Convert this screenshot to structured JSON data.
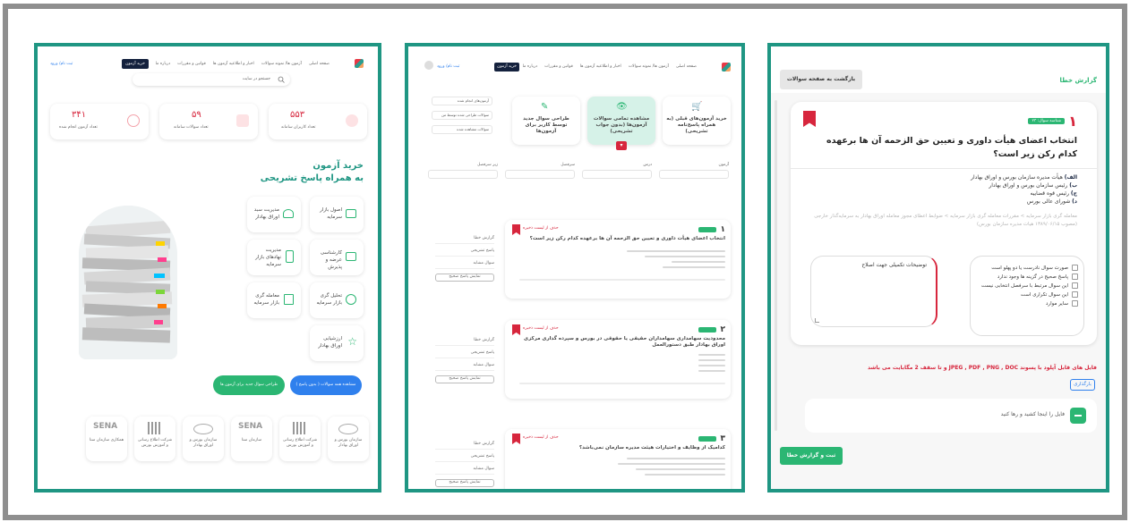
{
  "panel1": {
    "nav": [
      "صفحه اصلی",
      "آزمون ها/ نمونه سوالات",
      "اخبار و اطلاعیه آزمون ها",
      "قوانین و مقررات",
      "درباره ما"
    ],
    "buy_button": "خرید آزمون",
    "user_label": "ثبت نام/ ورود",
    "search_placeholder": "جستجو در سایت",
    "stats": [
      {
        "value": "۵۵۳",
        "label": "تعداد کاربران سامانه"
      },
      {
        "value": "۵۹",
        "label": "تعداد سوالات سامانه"
      },
      {
        "value": "۳۴۱",
        "label": "تعداد آزمون انجام شده"
      }
    ],
    "hero_title": "خرید آزمون",
    "hero_subtitle": "به همراه پاسخ تشریحی",
    "features": [
      {
        "label": "اصول بازار سرمایه"
      },
      {
        "label": "مدیریت سبد اوراق بهادار"
      },
      {
        "label": "کارشناسی عرضه و پذیرش"
      },
      {
        "label": "مدیریت نهادهای بازار سرمایه"
      },
      {
        "label": "تحلیل گری بازار سرمایه"
      },
      {
        "label": "معامله گری بازار سرمایه"
      },
      {
        "label": "ارزشیابی اوراق بهادار"
      }
    ],
    "cta_blue": "مشاهده همه سوالات ( بدون پاسخ )",
    "cta_green": "طراحی سوال جدید برای آزمون ها",
    "partners": [
      {
        "logo": "",
        "name": "سازمان بورس و اوراق بهادار"
      },
      {
        "logo": "",
        "name": "شرکت اطلاع رسانی و آموزش بورس"
      },
      {
        "logo": "SENA",
        "name": "سازمان سنا"
      },
      {
        "logo": "",
        "name": "سازمان بورس و اوراق بهادار"
      },
      {
        "logo": "",
        "name": "شرکت اطلاع رسانی و آموزش بورس"
      },
      {
        "logo": "SENA",
        "name": "همکاری سازمان سنا"
      }
    ]
  },
  "panel2": {
    "nav": [
      "صفحه اصلی",
      "آزمون ها/ نمونه سوالات",
      "اخبار و اطلاعیه آزمون ها",
      "قوانین و مقررات",
      "درباره ما"
    ],
    "buy_button": "خرید آزمون",
    "user_label": "ثبت نام/ ورود",
    "options": [
      {
        "label": "خرید آزمون‌های قبلی (به همراه پاسخ‌نامه تشریحی)"
      },
      {
        "label": "مشاهده تمامی سوالات آزمون‌ها (بدون جواب تشریحی)"
      },
      {
        "label": "طراحی سوال جدید توسط کاربر برای آزمون‌ها"
      }
    ],
    "side_links": [
      "آزمون‌های انجام شده",
      "سوالات طراحی شده توسط من",
      "سوالات مشاهده شده"
    ],
    "filters": [
      "آزمون",
      "درس",
      "سرفصل",
      "زیر سرفصل"
    ],
    "questions": [
      {
        "num": "۱",
        "text": "انتخاب اعضای هیأت داوری و تعیین حق الزحمه آن ها برعهده کدام رکن زیر است؟",
        "save": "حذف از لیست ذخیره"
      },
      {
        "num": "۲",
        "text": "محدودیت سهامداری سهامداران حقیقی یا حقوقی در بورس و سپرده گذاری مرکزی اوراق بهادار طبق دستورالعمل",
        "save": "حذف از لیست ذخیره"
      },
      {
        "num": "۳",
        "text": "کدامیک از وظایف و اختیارات هیئت مدیره سازمان نمی‌باشد؟",
        "save": "حذف از لیست ذخیره"
      }
    ],
    "actions": [
      "گزارش خطا",
      "پاسخ تشریحی",
      "سوال مشابه",
      "نمایش پاسخ صحیح"
    ]
  },
  "panel3": {
    "header_title": "گزارش خطا",
    "back_button": "بازگشت به صفحه سوالات",
    "q_number": "۱",
    "q_badge": "شناسه سوال: ۲۳",
    "q_text": "انتخاب اعضای هیأت داوری و تعیین حق الزحمه آن ها برعهده کدام رکن زیر است؟",
    "answers": [
      {
        "letter": "الف)",
        "text": "هیأت مدیره سازمان بورس و اوراق بهادار"
      },
      {
        "letter": "ب)",
        "text": "رئیس سازمان بورس و اوراق بهادار"
      },
      {
        "letter": "ج)",
        "text": "رئیس قوه قضاییه"
      },
      {
        "letter": "د)",
        "text": "شورای عالی بورس"
      }
    ],
    "source": "معامله گری بازار سرمایه > مقررات معامله گری بازار سرمایه > ضوابط اعطای مجوز معامله اوراق بهادار به سرمایه‌گذار خارجی (مصوب ۱۳۸۹/۰۶/۱۵ هیات مدیره سازمان بورس)",
    "reasons": [
      "صورت سوال نادرست یا دو پهلو است",
      "پاسخ صحیح در گزینه ها وجود ندارد",
      "این سوال مرتبط با سرفصل انتخابی نیست",
      "این سوال تکراری است",
      "سایر موارد"
    ],
    "comment_label": "توضیحات تکمیلی جهت اصلاح",
    "upload_note": "فایل های قابل آپلود با پسوند JPEG , PDF , PNG , DOC و تا سقف 2 مگابایت می باشد",
    "upload_button": "بارگذاری",
    "drop_text": "فایل را اینجا کشید و رها کنید",
    "submit_button": "ثبت و گزارش خطا"
  },
  "colors": {
    "teal": "#1f9683",
    "green": "#2bb673",
    "red": "#d7263d",
    "navy": "#14213d",
    "blue": "#2f80ed"
  }
}
